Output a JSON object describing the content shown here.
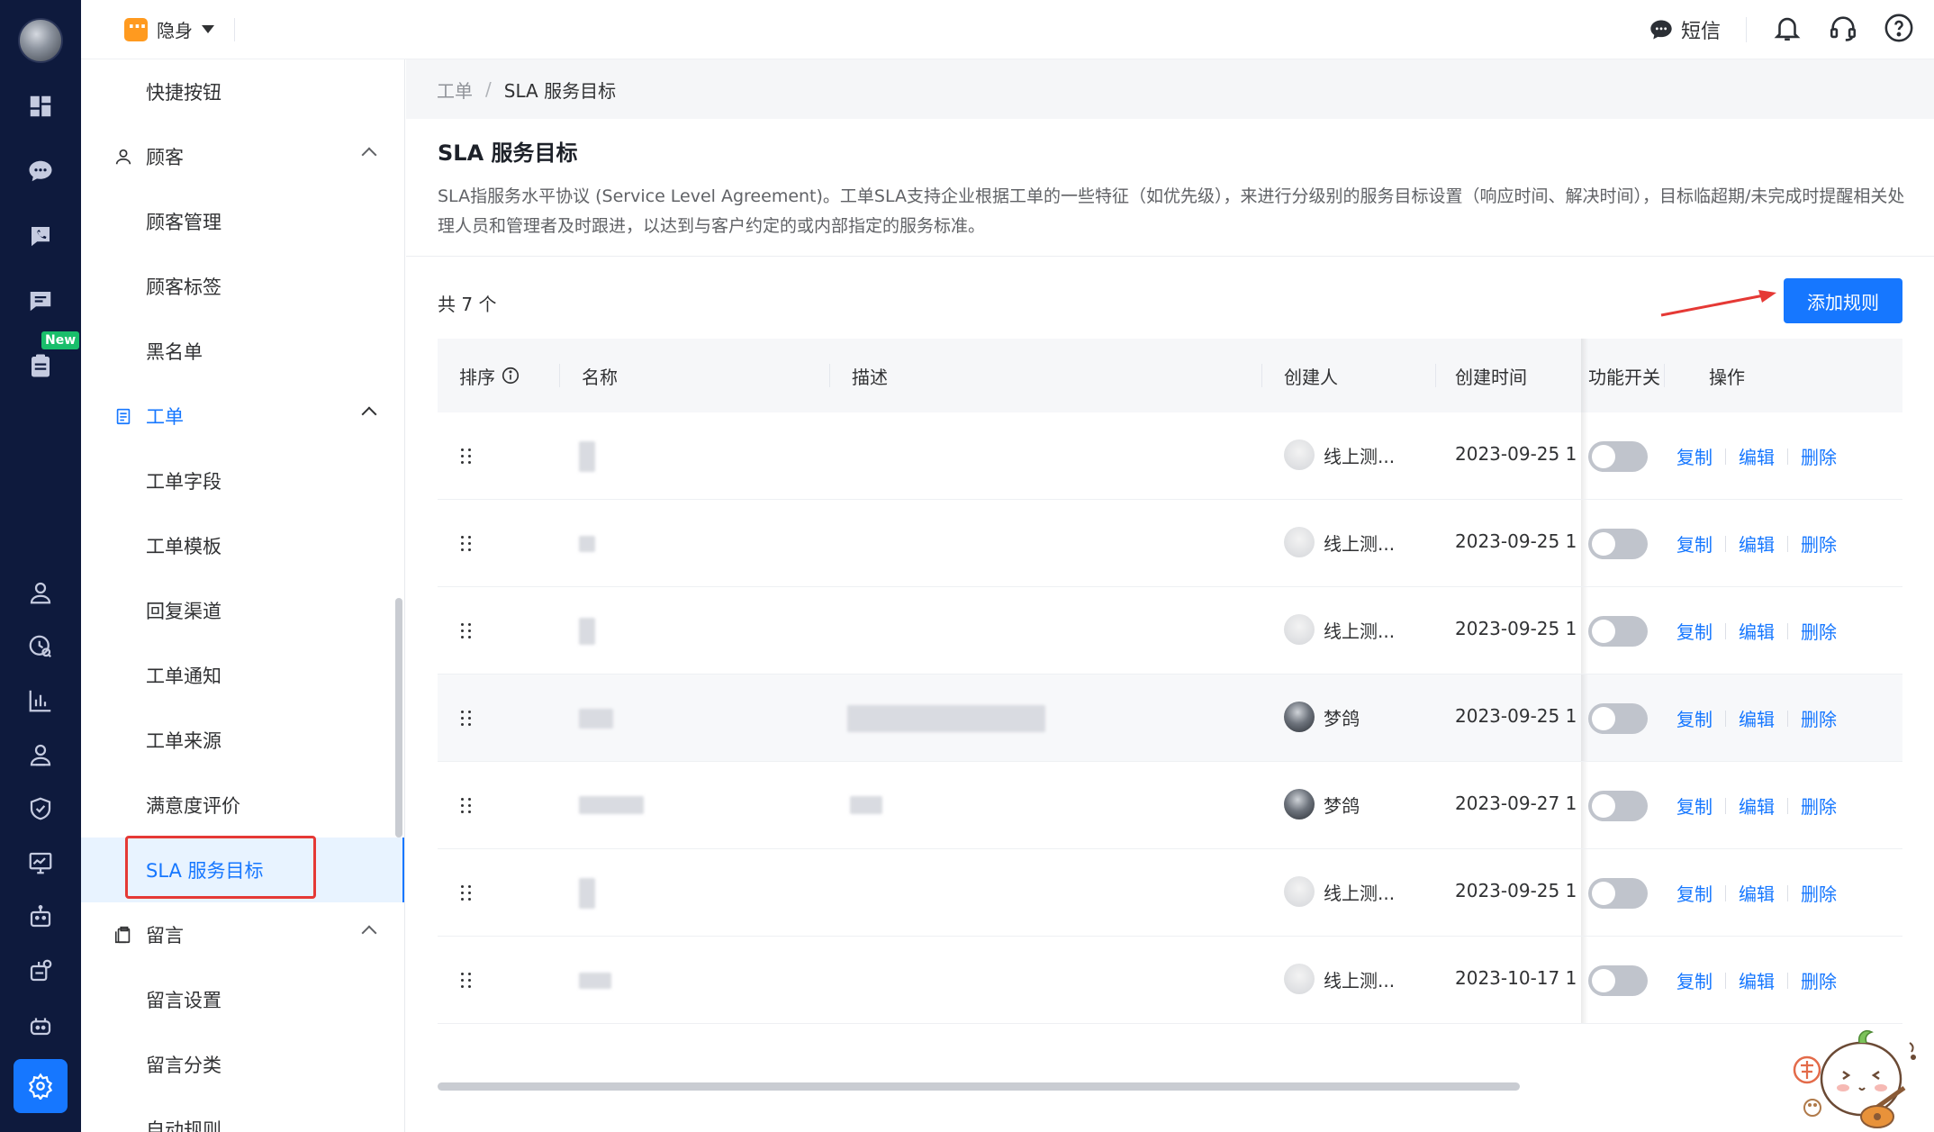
{
  "header": {
    "status_label": "隐身",
    "sms_label": "短信"
  },
  "rail": {
    "new_badge": "New"
  },
  "menu": {
    "items": [
      {
        "label": "快捷按钮",
        "kind": "sub"
      },
      {
        "label": "顾客",
        "kind": "group"
      },
      {
        "label": "顾客管理",
        "kind": "sub"
      },
      {
        "label": "顾客标签",
        "kind": "sub"
      },
      {
        "label": "黑名单",
        "kind": "sub"
      },
      {
        "label": "工单",
        "kind": "group-active"
      },
      {
        "label": "工单字段",
        "kind": "sub"
      },
      {
        "label": "工单模板",
        "kind": "sub"
      },
      {
        "label": "回复渠道",
        "kind": "sub"
      },
      {
        "label": "工单通知",
        "kind": "sub"
      },
      {
        "label": "工单来源",
        "kind": "sub"
      },
      {
        "label": "满意度评价",
        "kind": "sub"
      },
      {
        "label": "SLA 服务目标",
        "kind": "selected"
      },
      {
        "label": "留言",
        "kind": "group"
      },
      {
        "label": "留言设置",
        "kind": "sub"
      },
      {
        "label": "留言分类",
        "kind": "sub"
      },
      {
        "label": "自动规则",
        "kind": "sub"
      }
    ]
  },
  "breadcrumb": {
    "parent": "工单",
    "separator": "/",
    "current": "SLA 服务目标"
  },
  "page": {
    "title": "SLA 服务目标",
    "description": "SLA指服务水平协议 (Service Level Agreement)。工单SLA支持企业根据工单的一些特征（如优先级），来进行分级别的服务目标设置（响应时间、解决时间），目标临超期/未完成时提醒相关处理人员和管理者及时跟进，以达到与客户约定的或内部指定的服务标准。",
    "total": "共 7 个",
    "add_button": "添加规则"
  },
  "table": {
    "columns": {
      "sort": "排序",
      "name": "名称",
      "desc": "描述",
      "creator": "创建人",
      "created": "创建时间",
      "switch": "功能开关",
      "actions": "操作"
    },
    "actions": {
      "copy": "复制",
      "edit": "编辑",
      "delete": "删除"
    },
    "rows": [
      {
        "creator": "线上测...",
        "created": "2023-09-25 1",
        "enabled": false,
        "avatar": "light"
      },
      {
        "creator": "线上测...",
        "created": "2023-09-25 1",
        "enabled": false,
        "avatar": "light"
      },
      {
        "creator": "线上测...",
        "created": "2023-09-25 1",
        "enabled": false,
        "avatar": "light"
      },
      {
        "creator": "梦鸽",
        "created": "2023-09-25 1",
        "enabled": false,
        "avatar": "dark"
      },
      {
        "creator": "梦鸽",
        "created": "2023-09-27 1",
        "enabled": false,
        "avatar": "dark"
      },
      {
        "creator": "线上测...",
        "created": "2023-09-25 1",
        "enabled": false,
        "avatar": "light"
      },
      {
        "creator": "线上测...",
        "created": "2023-10-17 1",
        "enabled": false,
        "avatar": "light"
      }
    ]
  },
  "colors": {
    "primary": "#1677ff",
    "rail_bg": "#0e1a3d",
    "annotation_red": "#e53935"
  }
}
